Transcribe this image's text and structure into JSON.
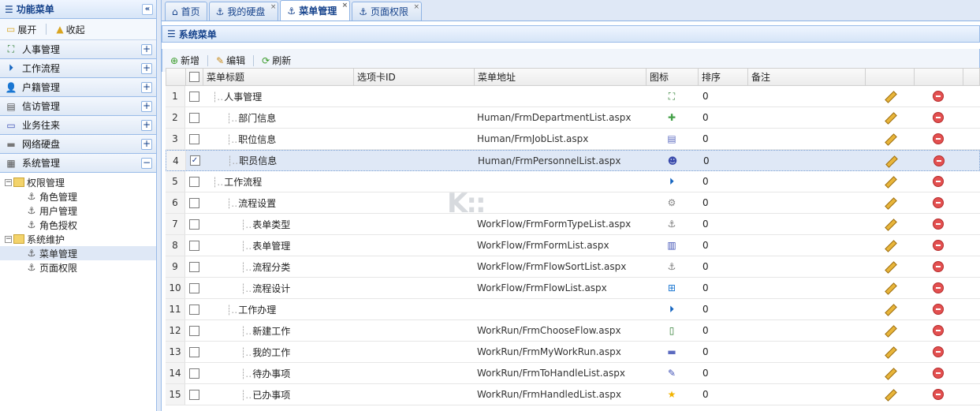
{
  "left_panel": {
    "title": "功能菜单",
    "collapse_glyph": "«",
    "expand_label": "展开",
    "collapse_label": "收起",
    "sections": [
      {
        "label": "人事管理",
        "toggle": "+",
        "icon": "org-chart-icon"
      },
      {
        "label": "工作流程",
        "toggle": "+",
        "icon": "flow-icon"
      },
      {
        "label": "户籍管理",
        "toggle": "+",
        "icon": "user-icon"
      },
      {
        "label": "信访管理",
        "toggle": "+",
        "icon": "form-icon"
      },
      {
        "label": "业务往来",
        "toggle": "+",
        "icon": "window-icon"
      },
      {
        "label": "网络硬盘",
        "toggle": "+",
        "icon": "disk-icon"
      },
      {
        "label": "系统管理",
        "toggle": "−",
        "icon": "settings-icon"
      }
    ],
    "tree": [
      {
        "label": "权限管理",
        "level": 0,
        "toggle": "−"
      },
      {
        "label": "角色管理",
        "level": 1
      },
      {
        "label": "用户管理",
        "level": 1
      },
      {
        "label": "角色授权",
        "level": 1
      },
      {
        "label": "系统维护",
        "level": 0,
        "toggle": "−"
      },
      {
        "label": "菜单管理",
        "level": 1,
        "selected": true
      },
      {
        "label": "页面权限",
        "level": 1
      }
    ]
  },
  "tabs": [
    {
      "label": "首页",
      "closable": false
    },
    {
      "label": "我的硬盘",
      "closable": true
    },
    {
      "label": "菜单管理",
      "closable": true,
      "active": true
    },
    {
      "label": "页面权限",
      "closable": true
    }
  ],
  "close_glyph": "×",
  "content": {
    "title": "系统菜单",
    "toolbar": {
      "add": "新增",
      "edit": "编辑",
      "refresh": "刷新"
    },
    "columns": [
      "菜单标题",
      "选项卡ID",
      "菜单地址",
      "图标",
      "排序",
      "备注"
    ],
    "rows": [
      {
        "num": "1",
        "title": "人事管理",
        "level": 0,
        "url": "",
        "icon": "org-chart-icon",
        "sort": "0"
      },
      {
        "num": "2",
        "title": "部门信息",
        "level": 1,
        "url": "Human/FrmDepartmentList.aspx",
        "icon": "puzzle-icon",
        "sort": "0"
      },
      {
        "num": "3",
        "title": "职位信息",
        "level": 1,
        "url": "Human/FrmJobList.aspx",
        "icon": "card-icon",
        "sort": "0"
      },
      {
        "num": "4",
        "title": "职员信息",
        "level": 1,
        "url": "Human/FrmPersonnelList.aspx",
        "icon": "person-icon",
        "sort": "0",
        "checked": true
      },
      {
        "num": "5",
        "title": "工作流程",
        "level": 0,
        "url": "",
        "icon": "flow-icon",
        "sort": "0"
      },
      {
        "num": "6",
        "title": "流程设置",
        "level": 1,
        "url": "",
        "icon": "gear-icon",
        "sort": "0"
      },
      {
        "num": "7",
        "title": "表单类型",
        "level": 2,
        "url": "WorkFlow/FrmFormTypeList.aspx",
        "icon": "anchor-icon",
        "sort": "0"
      },
      {
        "num": "8",
        "title": "表单管理",
        "level": 2,
        "url": "WorkFlow/FrmFormList.aspx",
        "icon": "doc-icon",
        "sort": "0"
      },
      {
        "num": "9",
        "title": "流程分类",
        "level": 2,
        "url": "WorkFlow/FrmFlowSortList.aspx",
        "icon": "anchor-icon",
        "sort": "0"
      },
      {
        "num": "10",
        "title": "流程设计",
        "level": 2,
        "url": "WorkFlow/FrmFlowList.aspx",
        "icon": "window-add-icon",
        "sort": "0"
      },
      {
        "num": "11",
        "title": "工作办理",
        "level": 1,
        "url": "",
        "icon": "flow-icon",
        "sort": "0"
      },
      {
        "num": "12",
        "title": "新建工作",
        "level": 2,
        "url": "WorkRun/FrmChooseFlow.aspx",
        "icon": "page-add-icon",
        "sort": "0"
      },
      {
        "num": "13",
        "title": "我的工作",
        "level": 2,
        "url": "WorkRun/FrmMyWorkRun.aspx",
        "icon": "tray-icon",
        "sort": "0"
      },
      {
        "num": "14",
        "title": "待办事项",
        "level": 2,
        "url": "WorkRun/FrmToHandleList.aspx",
        "icon": "note-edit-icon",
        "sort": "0"
      },
      {
        "num": "15",
        "title": "已办事项",
        "level": 2,
        "url": "WorkRun/FrmHandledList.aspx",
        "icon": "star-icon",
        "sort": "0"
      }
    ]
  },
  "colors": {
    "accent": "#15428b",
    "border": "#99bbe8",
    "selected": "#dfe8f6"
  }
}
